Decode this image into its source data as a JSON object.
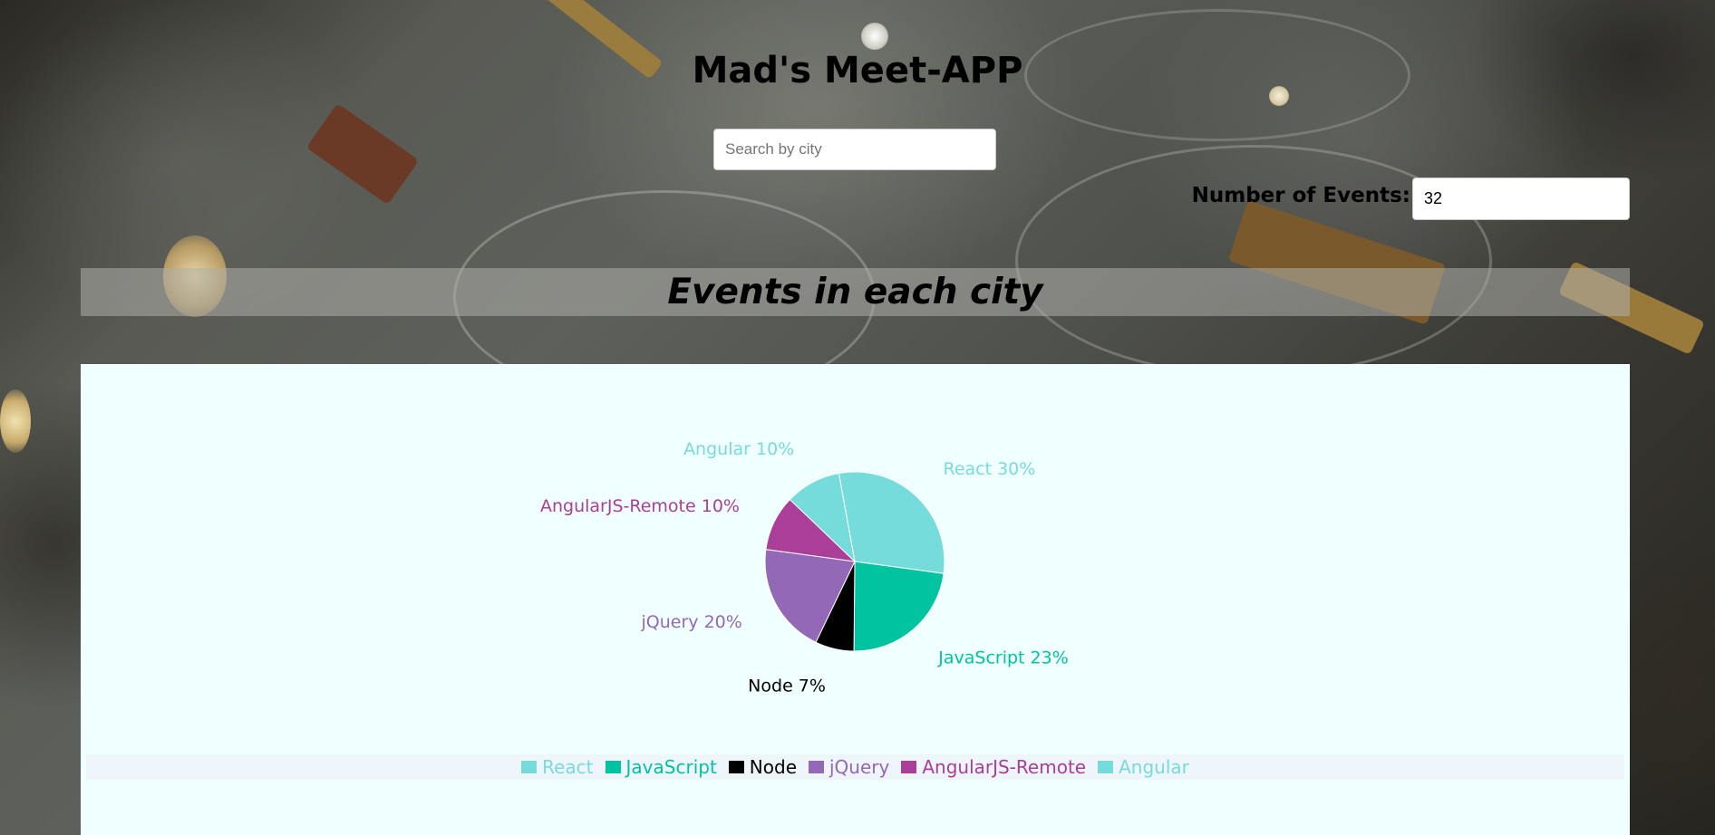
{
  "header": {
    "title": "Mad's Meet-APP"
  },
  "search": {
    "placeholder": "Search by city",
    "value": ""
  },
  "number_of_events": {
    "label": "Number of Events:",
    "value": "32"
  },
  "section": {
    "title": "Events in each city"
  },
  "chart_data": {
    "type": "pie",
    "title": "",
    "slices": [
      {
        "name": "React",
        "value": 30,
        "label": "React 30%",
        "color": "#76dbdb"
      },
      {
        "name": "JavaScript",
        "value": 23,
        "label": "JavaScript 23%",
        "color": "#00c49f"
      },
      {
        "name": "Node",
        "value": 7,
        "label": "Node 7%",
        "color": "#000000"
      },
      {
        "name": "jQuery",
        "value": 20,
        "label": "jQuery 20%",
        "color": "#9368b7"
      },
      {
        "name": "AngularJS-Remote",
        "value": 10,
        "label": "AngularJS-Remote 10%",
        "color": "#aa3e98"
      },
      {
        "name": "Angular",
        "value": 10,
        "label": "Angular 10%",
        "color": "#76dbdb"
      }
    ],
    "legend_position": "bottom"
  },
  "colors": {
    "panel_background": "#f0ffff",
    "legend_background": "#eef5fb"
  }
}
